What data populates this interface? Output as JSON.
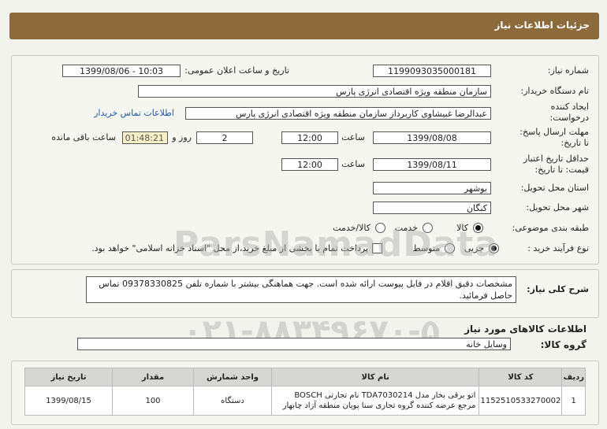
{
  "header": {
    "title": "جزئیات اطلاعات نیاز"
  },
  "form": {
    "need_number_label": "شماره نیاز:",
    "need_number": "1199093035000181",
    "announce_label": "تاریخ و ساعت اعلان عمومی:",
    "announce_value": "1399/08/06 - 10:03",
    "buyer_org_label": "نام دستگاه خریدار:",
    "buyer_org": "سازمان منطقه ویژه اقتصادی انرژی پارس",
    "creator_label_1": "ایجاد کننده",
    "creator_label_2": "درخواست:",
    "creator": "عبدالرضا غبیشاوی کاربرداز سازمان منطقه ویژه اقتصادی انرژی پارس",
    "contact_link": "اطلاعات تماس خریدار",
    "reply_deadline_label_1": "مهلت ارسال پاسخ:",
    "reply_deadline_label_2": "تا تاریخ:",
    "reply_date": "1399/08/08",
    "time_label": "ساعت",
    "reply_time": "12:00",
    "days_value": "2",
    "days_label": "روز و",
    "remaining_time": "01:48:21",
    "remaining_label": "ساعت باقی مانده",
    "validity_label_1": "حداقل تاریخ اعتبار",
    "validity_label_2": "قیمت: تا تاریخ:",
    "validity_date": "1399/08/11",
    "validity_time_label": "ساعت",
    "validity_time": "12:00",
    "province_label": "استان محل تحویل:",
    "province": "بوشهر",
    "city_label": "شهر محل تحویل:",
    "city": "کنگان",
    "category_label": "طبقه بندی موضوعی:",
    "category_options": [
      "کالا",
      "خدمت",
      "کالا/خدمت"
    ],
    "process_label": "نوع فرآیند خرید :",
    "process_options": [
      "جزیی",
      "متوسط"
    ],
    "payment_note": "پرداخت تمام یا بخشی از مبلغ خرید،از محل \"اسناد خزانه اسلامی\" خواهد بود."
  },
  "description": {
    "label": "شرح کلی نیاز:",
    "text": "مشخصات دقیق اقلام در فایل پیوست ارائه شده است. جهت هماهنگی بیشتر با شماره تلفن 09378330825 تماس حاصل فرمائید."
  },
  "goods": {
    "section_title": "اطلاعات کالاهای مورد نیاز",
    "group_label": "گروه کالا:",
    "group_value": "وسایل خانه",
    "columns": [
      "ردیف",
      "کد کالا",
      "نام کالا",
      "واحد شمارش",
      "مقدار",
      "تاریخ نیاز"
    ],
    "rows": [
      {
        "index": "1",
        "code": "1152510533270002",
        "name": "اتو برقی بخار مدل TDA7030214 نام تجارتی BOSCH مرجع عرضه کننده گروه تجاری سنا پویان منطقه آزاد چابهار",
        "unit": "دستگاه",
        "qty": "100",
        "date": "1399/08/15"
      }
    ]
  },
  "watermark": {
    "line1": "ParsNamadData",
    "line2": "۰۲۱-۸۸۳۴۹۶۷۰-۵"
  }
}
